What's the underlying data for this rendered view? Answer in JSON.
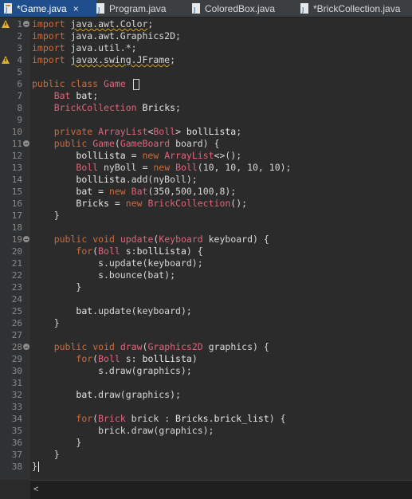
{
  "tabs": [
    {
      "label": "*Game.java",
      "active": true,
      "closable": true,
      "icon": "java-file-icon"
    },
    {
      "label": "Program.java",
      "active": false,
      "icon": "java-file-icon"
    },
    {
      "label": "ColoredBox.java",
      "active": false,
      "icon": "java-file-icon"
    },
    {
      "label": "*BrickCollection.java",
      "active": false,
      "icon": "java-file-icon"
    }
  ],
  "tab_close": "×",
  "colors": {
    "keyword": "#cc6c3c",
    "type": "#e0647a",
    "active_tab": "#1f4e8c",
    "background": "#2b2b2b"
  },
  "code": {
    "line_numbers": [
      "1",
      "2",
      "3",
      "4",
      "5",
      "6",
      "7",
      "8",
      "9",
      "10",
      "11",
      "12",
      "13",
      "14",
      "15",
      "16",
      "17",
      "18",
      "19",
      "20",
      "21",
      "22",
      "23",
      "24",
      "25",
      "26",
      "27",
      "28",
      "29",
      "30",
      "31",
      "32",
      "33",
      "34",
      "35",
      "36",
      "37",
      "38"
    ]
  },
  "scroll_left_arrow": "<"
}
